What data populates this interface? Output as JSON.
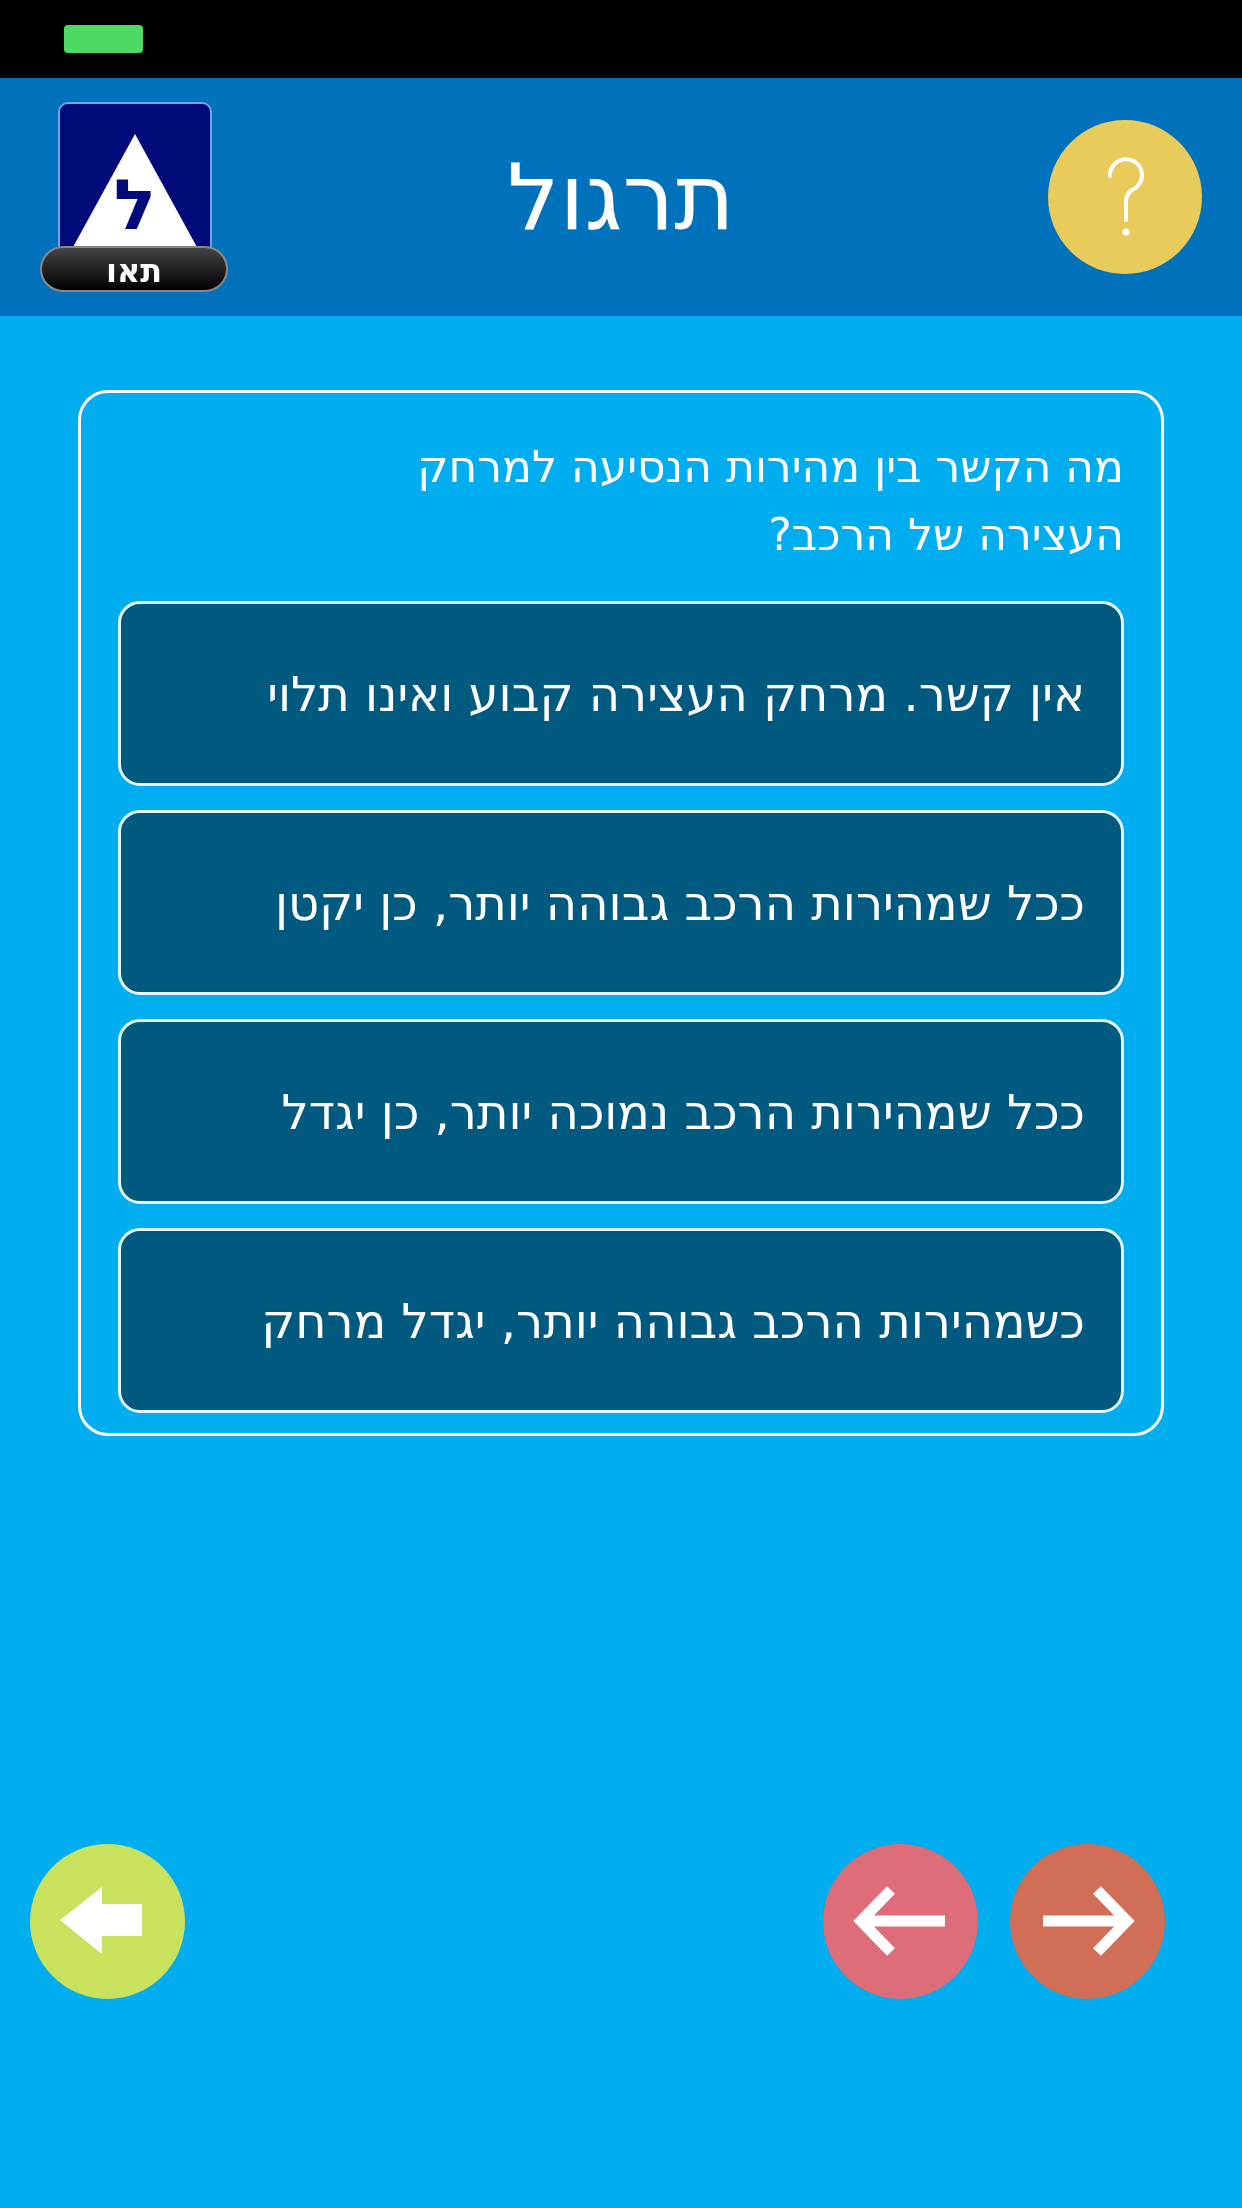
{
  "header": {
    "title": "תרגול",
    "logo_letter": "ל",
    "logo_caption": "תאו"
  },
  "question": {
    "text": "מה הקשר בין מהירות הנסיעה למרחק העצירה של הרכב?",
    "answers": [
      {
        "text": "אין קשר. מרחק העצירה קבוע ואינו תלוי"
      },
      {
        "text": "ככל שמהירות הרכב גבוהה יותר, כן יקטן"
      },
      {
        "text": "ככל שמהירות הרכב נמוכה יותר, כן יגדל"
      },
      {
        "text": "כשמהירות הרכב גבוהה יותר, יגדל מרחק"
      }
    ]
  }
}
